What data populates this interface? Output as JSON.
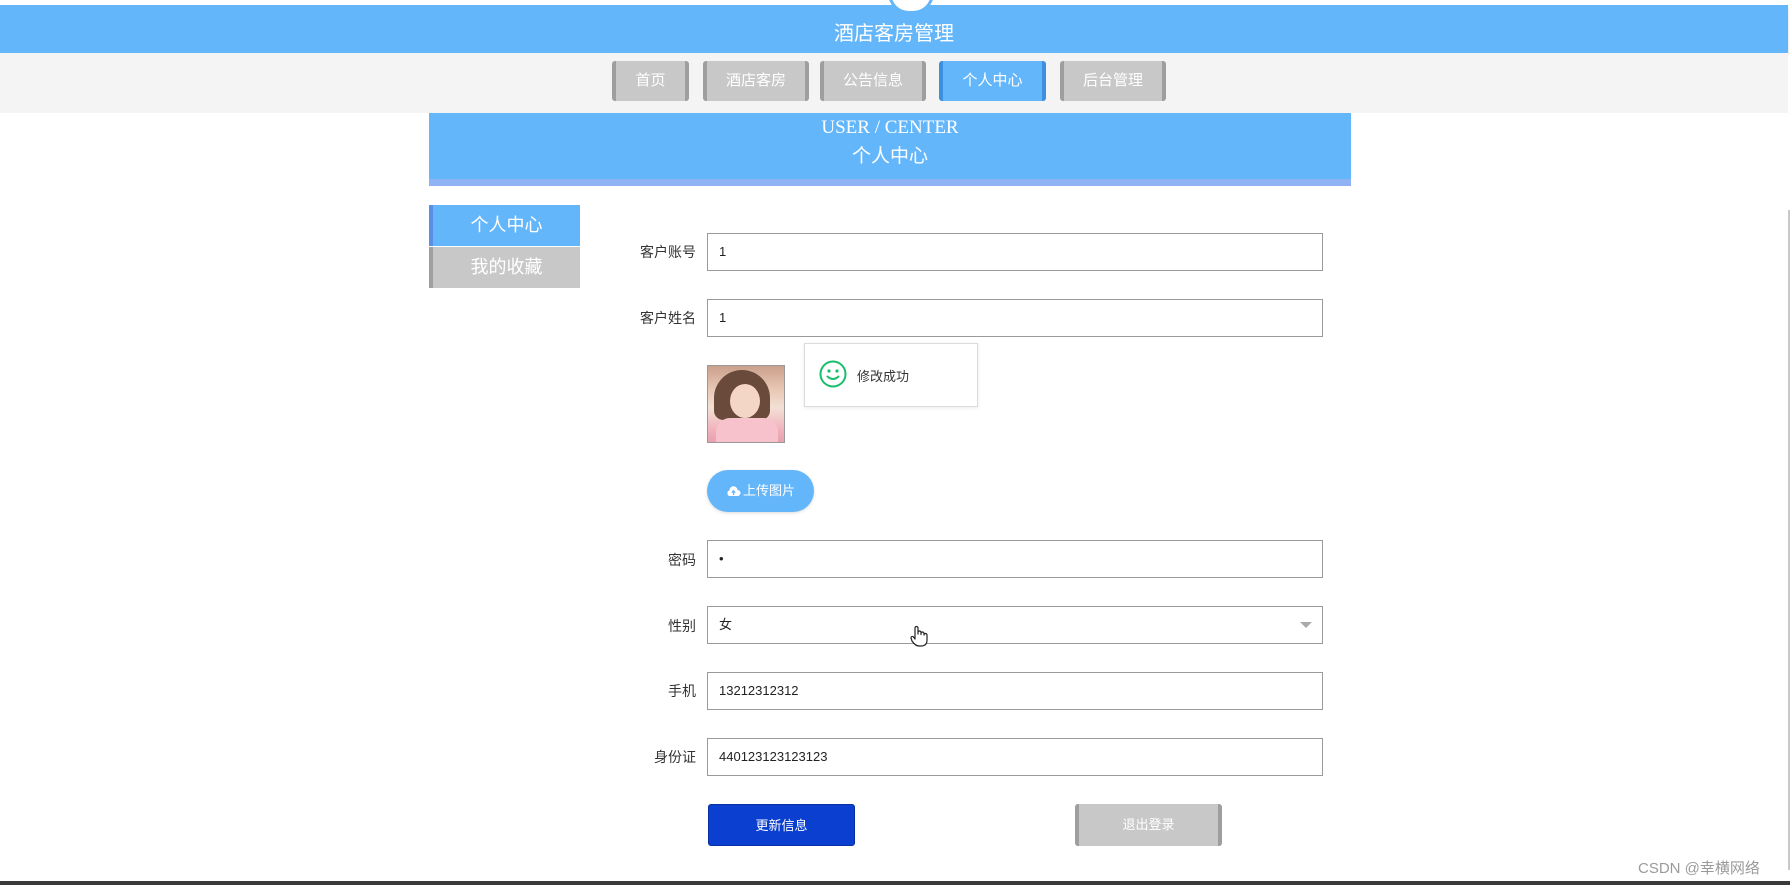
{
  "header": {
    "title": "酒店客房管理"
  },
  "nav": {
    "items": [
      {
        "label": "首页",
        "active": false
      },
      {
        "label": "酒店客房",
        "active": false
      },
      {
        "label": "公告信息",
        "active": false
      },
      {
        "label": "个人中心",
        "active": true
      },
      {
        "label": "后台管理",
        "active": false
      }
    ]
  },
  "banner": {
    "en": "USER / CENTER",
    "cn": "个人中心"
  },
  "sidebar": {
    "items": [
      {
        "label": "个人中心",
        "active": true
      },
      {
        "label": "我的收藏",
        "active": false
      }
    ]
  },
  "form": {
    "account": {
      "label": "客户账号",
      "value": "1"
    },
    "name": {
      "label": "客户姓名",
      "value": "1"
    },
    "password": {
      "label": "密码",
      "value": "•"
    },
    "gender": {
      "label": "性别",
      "value": "女"
    },
    "phone": {
      "label": "手机",
      "value": "13212312312"
    },
    "idcard": {
      "label": "身份证",
      "value": "440123123123123"
    }
  },
  "upload": {
    "label": "上传图片"
  },
  "toast": {
    "message": "修改成功",
    "icon": "smile-icon"
  },
  "actions": {
    "update_label": "更新信息",
    "logout_label": "退出登录"
  },
  "watermark": "CSDN @幸横网络",
  "colors": {
    "primary": "#64b6fb",
    "update_button": "#0b3fd0",
    "inactive": "#c8c8c8",
    "success": "#19be6b"
  }
}
